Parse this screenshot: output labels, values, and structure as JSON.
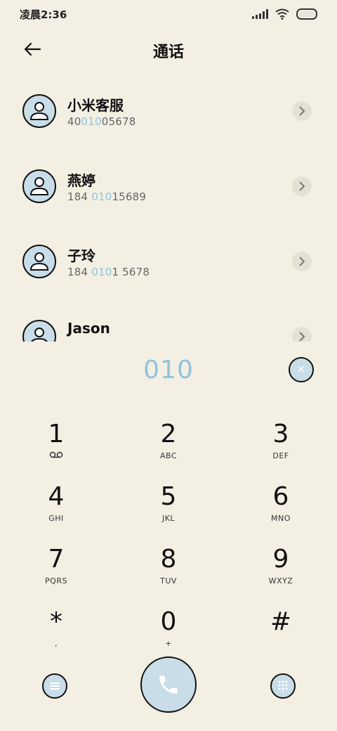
{
  "status_bar": {
    "time": "凌晨2:36"
  },
  "header": {
    "title": "通话"
  },
  "contacts": [
    {
      "name": "小米客服",
      "num_pre": "40",
      "num_hl": "010",
      "num_post": "05678"
    },
    {
      "name": "燕婷",
      "num_pre": "184 ",
      "num_hl": "010",
      "num_post": "15689"
    },
    {
      "name": "子玲",
      "num_pre": "184 ",
      "num_hl": "010",
      "num_post": "1 5678"
    },
    {
      "name": "Jason",
      "num_pre": "",
      "num_hl": "",
      "num_post": ""
    }
  ],
  "dialer": {
    "entered": "010"
  },
  "keypad": [
    {
      "digit": "1",
      "letters": ""
    },
    {
      "digit": "2",
      "letters": "ABC"
    },
    {
      "digit": "3",
      "letters": "DEF"
    },
    {
      "digit": "4",
      "letters": "GHI"
    },
    {
      "digit": "5",
      "letters": "JKL"
    },
    {
      "digit": "6",
      "letters": "MNO"
    },
    {
      "digit": "7",
      "letters": "PQRS"
    },
    {
      "digit": "8",
      "letters": "TUV"
    },
    {
      "digit": "9",
      "letters": "WXYZ"
    },
    {
      "digit": "*",
      "letters": ","
    },
    {
      "digit": "0",
      "letters": "+"
    },
    {
      "digit": "#",
      "letters": ""
    }
  ],
  "colors": {
    "background": "#f4efe3",
    "accent": "#8fc4dd",
    "icon_fill": "#c8dde8"
  }
}
